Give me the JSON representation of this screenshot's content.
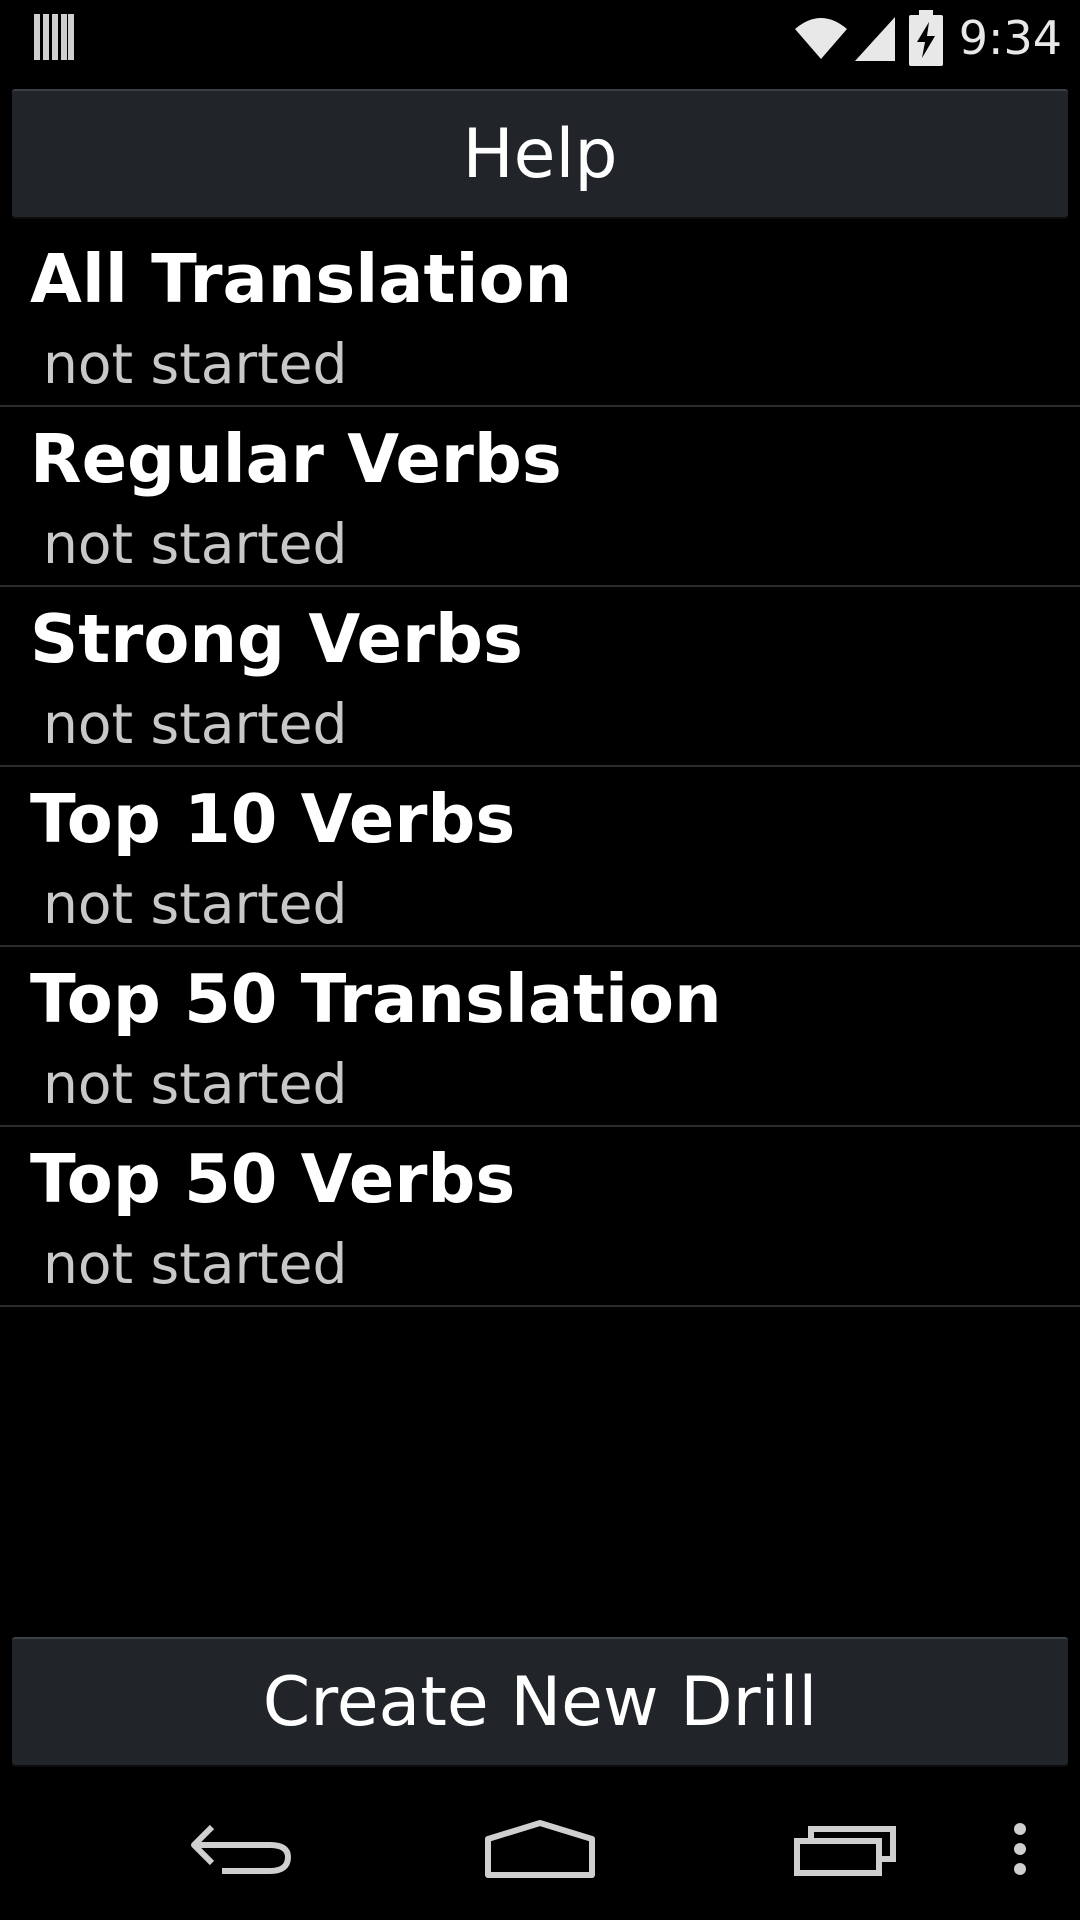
{
  "status_bar": {
    "time": "9:34",
    "icons": [
      "notification-icon",
      "wifi-icon",
      "signal-icon",
      "battery-charging-icon"
    ]
  },
  "header": {
    "help_label": "Help"
  },
  "drills": [
    {
      "title": "All Translation",
      "status": "not started"
    },
    {
      "title": "Regular Verbs",
      "status": "not started"
    },
    {
      "title": "Strong Verbs",
      "status": "not started"
    },
    {
      "title": "Top 10 Verbs",
      "status": "not started"
    },
    {
      "title": "Top 50 Translation",
      "status": "not started"
    },
    {
      "title": "Top 50 Verbs",
      "status": "not started"
    }
  ],
  "footer": {
    "create_label": "Create New Drill"
  },
  "nav_bar": {
    "icons": [
      "back-icon",
      "home-icon",
      "recents-icon",
      "overflow-menu-icon"
    ]
  },
  "colors": {
    "background": "#000000",
    "button": "#212529",
    "divider": "#2b2b2b",
    "text_primary": "#ffffff",
    "text_secondary": "#c8c8c8"
  }
}
